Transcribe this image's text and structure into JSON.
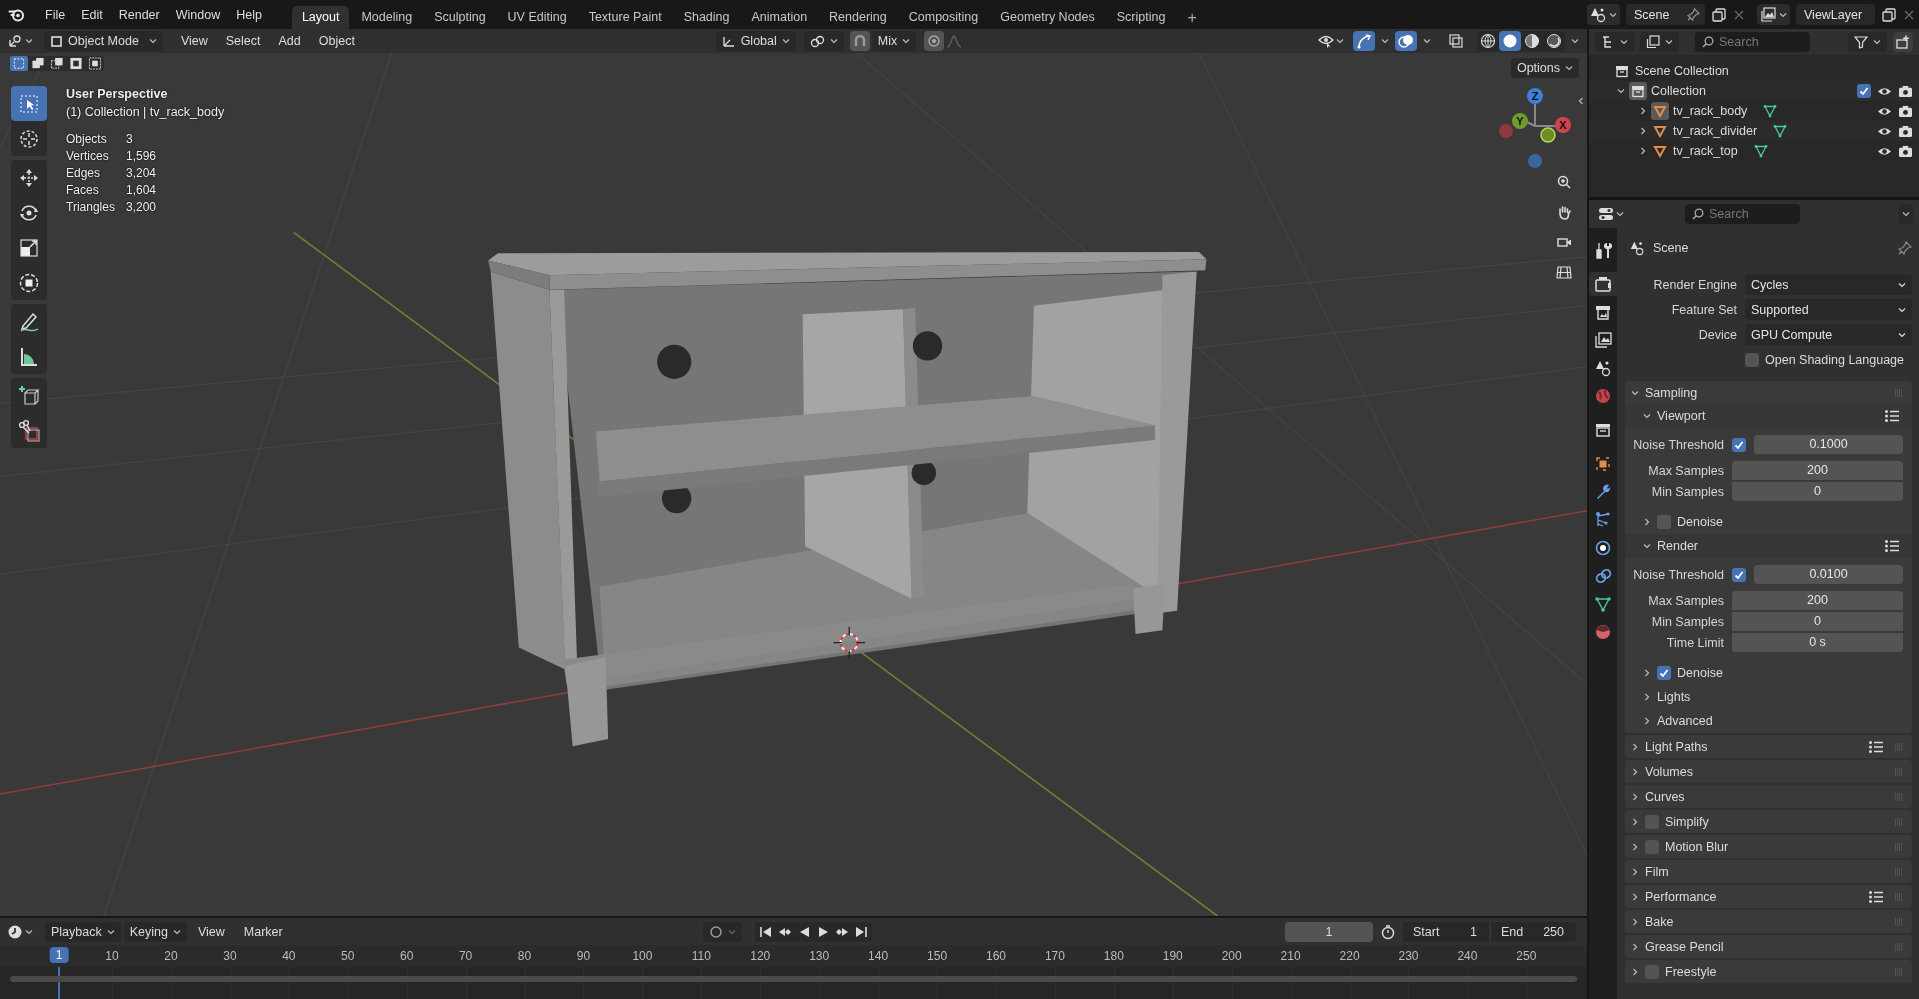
{
  "top_bar": {
    "menus": [
      "File",
      "Edit",
      "Render",
      "Window",
      "Help"
    ],
    "workspace_tabs": [
      {
        "label": "Layout",
        "selected": true
      },
      {
        "label": "Modeling",
        "selected": false
      },
      {
        "label": "Sculpting",
        "selected": false
      },
      {
        "label": "UV Editing",
        "selected": false
      },
      {
        "label": "Texture Paint",
        "selected": false
      },
      {
        "label": "Shading",
        "selected": false
      },
      {
        "label": "Animation",
        "selected": false
      },
      {
        "label": "Rendering",
        "selected": false
      },
      {
        "label": "Compositing",
        "selected": false
      },
      {
        "label": "Geometry Nodes",
        "selected": false
      },
      {
        "label": "Scripting",
        "selected": false
      }
    ],
    "add_tab": "+",
    "scene": "Scene",
    "view_layer": "ViewLayer"
  },
  "viewport": {
    "header": {
      "mode": "Object Mode",
      "menus": [
        "View",
        "Select",
        "Add",
        "Object"
      ],
      "orientation": "Global",
      "snap_target": "Mix",
      "gizmos_on": true,
      "overlays_on": true,
      "xray_on": false,
      "shading_modes": [
        {
          "selected": false
        },
        {
          "selected": true
        },
        {
          "selected": false
        },
        {
          "selected": false
        }
      ]
    },
    "select_modes": [
      {
        "selected": true
      },
      {
        "selected": false
      },
      {
        "selected": false
      },
      {
        "selected": false
      },
      {
        "selected": false
      }
    ],
    "options": "Options",
    "tool_groups": [
      [
        {
          "kind": "select",
          "selected": true
        },
        {
          "kind": "cursor",
          "selected": false
        }
      ],
      [
        {
          "kind": "move",
          "selected": false
        },
        {
          "kind": "rotate",
          "selected": false
        },
        {
          "kind": "scale",
          "selected": false
        },
        {
          "kind": "transform",
          "selected": false
        }
      ],
      [
        {
          "kind": "annotate",
          "selected": false
        },
        {
          "kind": "measure",
          "selected": false
        }
      ],
      [
        {
          "kind": "add-cube",
          "selected": false
        },
        {
          "kind": "cut",
          "selected": false
        }
      ]
    ],
    "view_name": "User Perspective",
    "context": "(1) Collection | tv_rack_body",
    "stats": [
      {
        "label": "Objects",
        "value": "3"
      },
      {
        "label": "Vertices",
        "value": "1,596"
      },
      {
        "label": "Edges",
        "value": "3,204"
      },
      {
        "label": "Faces",
        "value": "1,604"
      },
      {
        "label": "Triangles",
        "value": "3,200"
      }
    ],
    "gizmo_axes": [
      "Z",
      "Y",
      "X"
    ]
  },
  "timeline": {
    "menus": [
      {
        "label": "Playback",
        "kind": "dropdown"
      },
      {
        "label": "Keying",
        "kind": "dropdown"
      },
      {
        "label": "View",
        "kind": "menu"
      },
      {
        "label": "Marker",
        "kind": "menu"
      }
    ],
    "current_frame": "1",
    "start": {
      "label": "Start",
      "value": "1"
    },
    "end": {
      "label": "End",
      "value": "250"
    },
    "playhead": "1",
    "ruler": [
      "10",
      "20",
      "30",
      "40",
      "50",
      "60",
      "70",
      "80",
      "90",
      "100",
      "110",
      "120",
      "130",
      "140",
      "150",
      "160",
      "170",
      "180",
      "190",
      "200",
      "210",
      "220",
      "230",
      "240",
      "250"
    ]
  },
  "outliner": {
    "search_placeholder": "Search",
    "root": "Scene Collection",
    "collections": [
      {
        "name": "Collection",
        "expanded": true,
        "checked": true,
        "children": [
          {
            "name": "tv_rack_body",
            "active": true,
            "expanded": false
          },
          {
            "name": "tv_rack_divider",
            "active": false,
            "expanded": false
          },
          {
            "name": "tv_rack_top",
            "active": false,
            "expanded": false
          }
        ]
      }
    ]
  },
  "properties": {
    "search_placeholder": "Search",
    "tab_groups": [
      [
        {
          "kind": "tool",
          "selected": false
        }
      ],
      [
        {
          "kind": "render",
          "selected": true
        },
        {
          "kind": "output",
          "selected": false
        },
        {
          "kind": "view-layer",
          "selected": false
        },
        {
          "kind": "scene",
          "selected": false
        },
        {
          "kind": "world",
          "selected": false
        }
      ],
      [
        {
          "kind": "collection",
          "selected": false
        }
      ],
      [
        {
          "kind": "object",
          "selected": false
        },
        {
          "kind": "modifiers",
          "selected": false
        },
        {
          "kind": "particles",
          "selected": false
        },
        {
          "kind": "physics",
          "selected": false
        },
        {
          "kind": "constraints",
          "selected": false
        },
        {
          "kind": "data",
          "selected": false
        },
        {
          "kind": "material",
          "selected": false
        }
      ]
    ],
    "context": "Scene",
    "settings": [
      {
        "label": "Render Engine",
        "value": "Cycles"
      },
      {
        "label": "Feature Set",
        "value": "Supported"
      },
      {
        "label": "Device",
        "value": "GPU Compute"
      }
    ],
    "osl": {
      "label": "Open Shading Language",
      "checked": false
    },
    "panels": [
      {
        "label": "Sampling",
        "expanded": true,
        "subpanels": [
          {
            "label": "Viewport",
            "expanded": true,
            "presets": true,
            "rows": [
              {
                "kind": "toggle",
                "label": "Noise Threshold",
                "checked": true,
                "value": "0.1000"
              },
              {
                "kind": "value",
                "label": "Max Samples",
                "value": "200"
              },
              {
                "kind": "value",
                "label": "Min Samples",
                "value": "0"
              }
            ]
          },
          {
            "label": "Denoise",
            "expanded": false,
            "checked": false
          },
          {
            "label": "Render",
            "expanded": true,
            "presets": true,
            "rows": [
              {
                "kind": "toggle",
                "label": "Noise Threshold",
                "checked": true,
                "value": "0.0100"
              },
              {
                "kind": "value",
                "label": "Max Samples",
                "value": "200"
              },
              {
                "kind": "value",
                "label": "Min Samples",
                "value": "0"
              },
              {
                "kind": "value",
                "label": "Time Limit",
                "value": "0 s"
              }
            ]
          },
          {
            "label": "Denoise",
            "expanded": false,
            "checked": true
          },
          {
            "label": "Lights",
            "expanded": false
          },
          {
            "label": "Advanced",
            "expanded": false
          }
        ]
      },
      {
        "label": "Light Paths",
        "expanded": false,
        "presets": true
      },
      {
        "label": "Volumes",
        "expanded": false
      },
      {
        "label": "Curves",
        "expanded": false
      },
      {
        "label": "Simplify",
        "expanded": false,
        "checked": false
      },
      {
        "label": "Motion Blur",
        "expanded": false,
        "checked": false
      },
      {
        "label": "Film",
        "expanded": false
      },
      {
        "label": "Performance",
        "expanded": false,
        "presets": true
      },
      {
        "label": "Bake",
        "expanded": false
      },
      {
        "label": "Grease Pencil",
        "expanded": false
      },
      {
        "label": "Freestyle",
        "expanded": false,
        "checked": false
      }
    ]
  }
}
